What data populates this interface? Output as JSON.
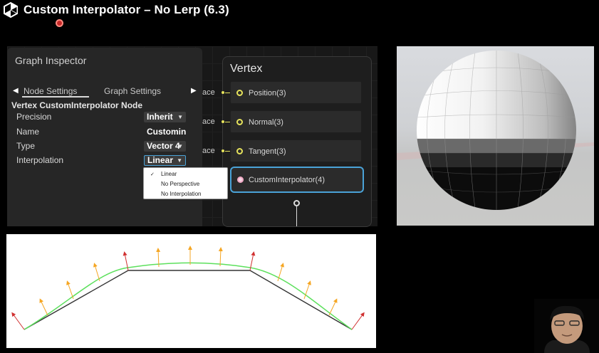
{
  "title": "Custom Interpolator – No Lerp (6.3)",
  "inspector": {
    "title": "Graph Inspector",
    "tabs": [
      "Node Settings",
      "Graph Settings"
    ],
    "section_title": "Vertex CustomInterpolator Node",
    "properties": [
      {
        "label": "Precision",
        "value": "Inherit"
      },
      {
        "label": "Name",
        "value": "Customin"
      },
      {
        "label": "Type",
        "value": "Vector 4"
      },
      {
        "label": "Interpolation",
        "value": "Linear"
      }
    ],
    "interpolation_menu": {
      "options": [
        "Linear",
        "No Perspective",
        "No Interpolation"
      ],
      "selected": "Linear"
    }
  },
  "vertex_node": {
    "title": "Vertex",
    "inputs": [
      "Position(3)",
      "Normal(3)",
      "Tangent(3)",
      "CustomInterpolator(4)"
    ],
    "wire_label": "ace"
  },
  "icons": {
    "logo": "unity-logo-icon",
    "record": "record-indicator-icon",
    "tab_left": "chevron-left-icon",
    "tab_right": "chevron-right-icon",
    "caret": "caret-down-icon",
    "check": "checkmark-icon"
  },
  "colors": {
    "accent": "#4aa3d8",
    "port_vector": "#e6e35c",
    "port_custom": "#f0a9c4",
    "record": "#c62828",
    "curve_green": "#5ce05c",
    "arrow_red": "#d03030",
    "arrow_orange": "#f5a623"
  }
}
